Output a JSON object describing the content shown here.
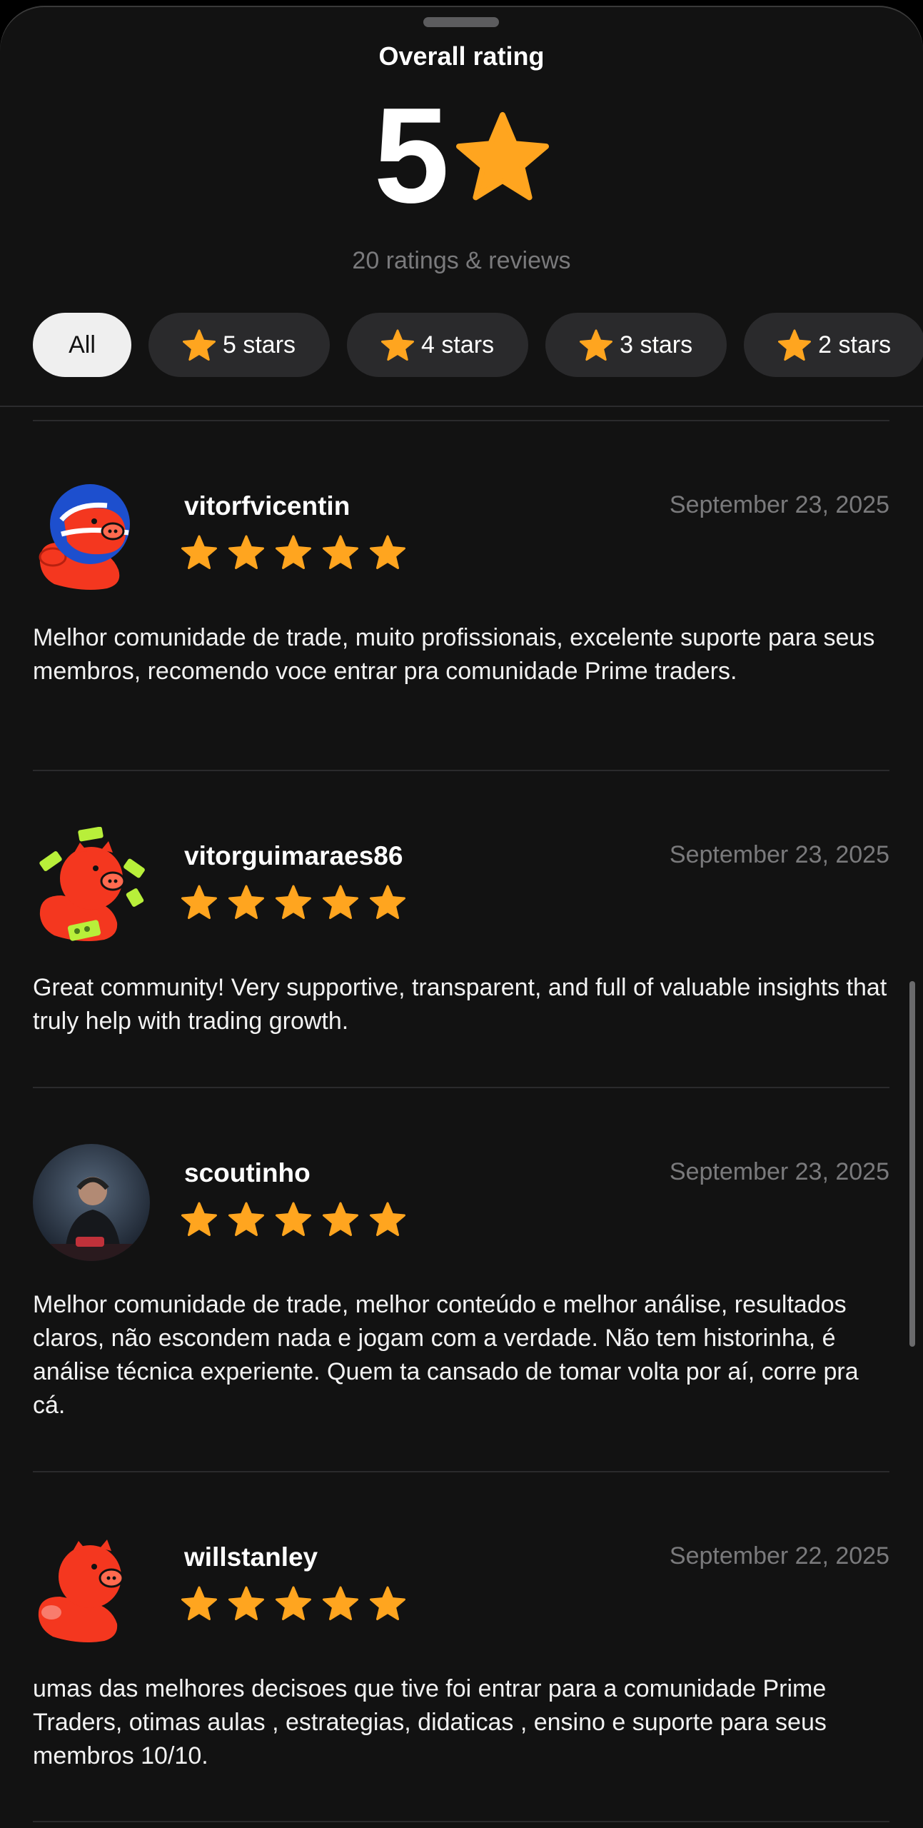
{
  "header": {
    "title": "Overall rating",
    "rating_value": "5",
    "rating_count_text": "20 ratings & reviews"
  },
  "filters": [
    {
      "label": "All",
      "active": true
    },
    {
      "label": "5 stars",
      "active": false
    },
    {
      "label": "4 stars",
      "active": false
    },
    {
      "label": "3 stars",
      "active": false
    },
    {
      "label": "2 stars",
      "active": false
    }
  ],
  "reviews": [
    {
      "username": "vitorfvicentin",
      "date": "September 23, 2025",
      "rating": 5,
      "text": "Melhor comunidade de trade, muito profissionais, excelente suporte para seus membros, recomendo voce entrar pra comunidade Prime traders.",
      "avatar_icon": "football-pig-avatar-icon"
    },
    {
      "username": "vitorguimaraes86",
      "date": "September 23, 2025",
      "rating": 5,
      "text": "Great community! Very supportive, transparent, and full of valuable insights that truly help with trading growth.",
      "avatar_icon": "money-pig-avatar-icon"
    },
    {
      "username": "scoutinho",
      "date": "September 23, 2025",
      "rating": 5,
      "text": "Melhor comunidade de trade, melhor conteúdo e melhor análise, resultados claros, não escondem nada e jogam com a verdade. Não tem historinha, é análise técnica experiente. Quem ta cansado de tomar volta por aí,  corre pra cá.",
      "avatar_icon": "photo-avatar-icon"
    },
    {
      "username": "willstanley",
      "date": "September 22, 2025",
      "rating": 5,
      "text": "umas das melhores decisoes que tive foi entrar para a comunidade Prime Traders, otimas aulas , estrategias, didaticas , ensino e suporte para seus membros 10/10.",
      "avatar_icon": "pig-avatar-icon"
    }
  ],
  "colors": {
    "background": "#121212",
    "star": "#FFA51F",
    "chip": "#2A2A2C",
    "chip_active": "#EFEFEF",
    "muted_text": "#7A7A7C"
  }
}
